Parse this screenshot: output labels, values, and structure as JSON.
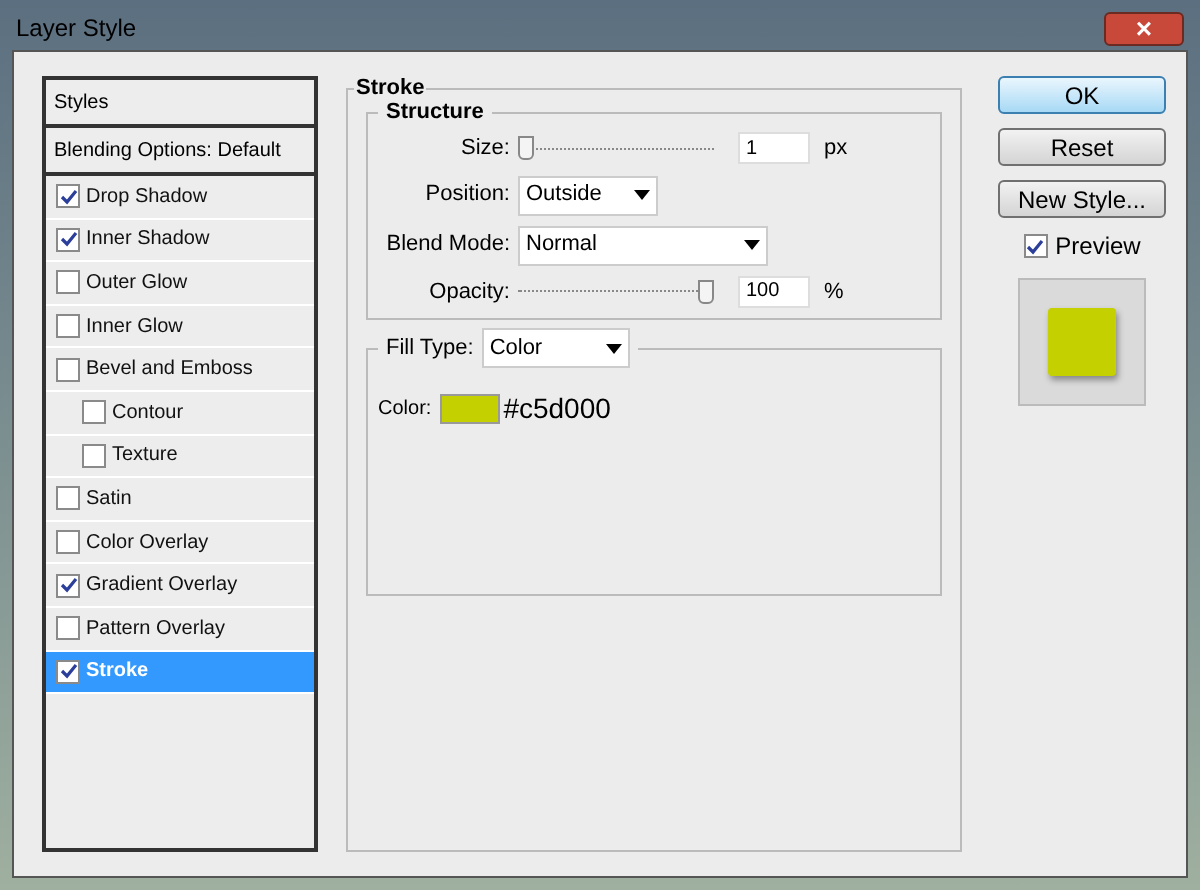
{
  "window": {
    "title": "Layer Style",
    "close": "×"
  },
  "styles_list": [
    {
      "kind": "header",
      "label": "Styles"
    },
    {
      "kind": "header",
      "label": "Blending Options: Default"
    },
    {
      "kind": "option",
      "label": "Drop Shadow",
      "checked": true,
      "selected": false
    },
    {
      "kind": "option",
      "label": "Inner Shadow",
      "checked": true,
      "selected": false
    },
    {
      "kind": "option",
      "label": "Outer Glow",
      "checked": false,
      "selected": false
    },
    {
      "kind": "option",
      "label": "Inner Glow",
      "checked": false,
      "selected": false
    },
    {
      "kind": "option",
      "label": "Bevel and Emboss",
      "checked": false,
      "selected": false,
      "children": [
        {
          "kind": "option",
          "label": "Contour",
          "checked": false,
          "selected": false
        },
        {
          "kind": "option",
          "label": "Texture",
          "checked": false,
          "selected": false
        }
      ]
    },
    {
      "kind": "option",
      "label": "Satin",
      "checked": false,
      "selected": false
    },
    {
      "kind": "option",
      "label": "Color Overlay",
      "checked": false,
      "selected": false
    },
    {
      "kind": "option",
      "label": "Gradient Overlay",
      "checked": true,
      "selected": false
    },
    {
      "kind": "option",
      "label": "Pattern Overlay",
      "checked": false,
      "selected": false
    },
    {
      "kind": "option",
      "label": "Stroke",
      "checked": true,
      "selected": true
    }
  ],
  "stroke": {
    "title": "Stroke",
    "structure": {
      "title": "Structure",
      "size": {
        "label": "Size:",
        "level": 0,
        "value": "1",
        "unit": "px"
      },
      "position": {
        "label": "Position:",
        "value": "Outside"
      },
      "blend_mode": {
        "label": "Blend Mode:",
        "value": "Normal"
      },
      "opacity": {
        "label": "Opacity:",
        "level": 1,
        "value": "100",
        "unit": "%"
      }
    },
    "fill_type": {
      "label": "Fill Type:",
      "value": "Color"
    },
    "color": {
      "label": "Color:",
      "color": "#c5d000",
      "hex": "#c5d000"
    }
  },
  "buttons": [
    "OK",
    "Reset",
    "New Style..."
  ],
  "preview": {
    "label": "Preview",
    "checked": true,
    "color": "#c5d000"
  }
}
